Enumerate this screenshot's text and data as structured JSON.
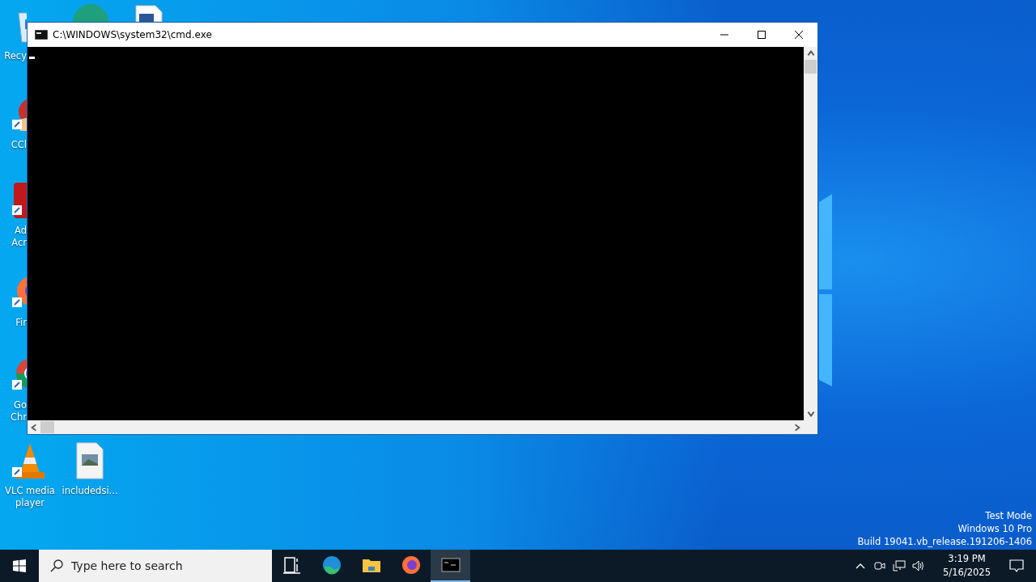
{
  "desktop": {
    "icons": [
      {
        "kind": "recycle",
        "lines": [
          "Recy"
        ]
      },
      {
        "kind": "ccleaner",
        "lines": [
          "CCl"
        ]
      },
      {
        "kind": "acrobat",
        "lines": [
          "Ad",
          "Acr"
        ]
      },
      {
        "kind": "firefox",
        "lines": [
          "Fir"
        ]
      },
      {
        "kind": "chrome",
        "lines": [
          "Go",
          "Chr"
        ]
      },
      {
        "kind": "vlc",
        "lines": [
          "VLC media",
          "player"
        ]
      },
      {
        "kind": "image-file",
        "lines": [
          "includedsi..."
        ]
      }
    ],
    "system_notice": [
      "Test Mode",
      "Windows 10 Pro",
      "Build 19041.vb_release.191206-1406"
    ]
  },
  "window": {
    "title": "C:\\WINDOWS\\system32\\cmd.exe"
  },
  "taskbar": {
    "search": {
      "placeholder": "Type here to search"
    },
    "apps": [
      {
        "kind": "task-view",
        "selected": false
      },
      {
        "kind": "edge",
        "selected": false
      },
      {
        "kind": "explorer",
        "selected": false
      },
      {
        "kind": "firefox",
        "selected": false
      },
      {
        "kind": "console",
        "selected": true
      }
    ],
    "clock": {
      "time": "3:19 PM",
      "date": "5/16/2025"
    }
  }
}
